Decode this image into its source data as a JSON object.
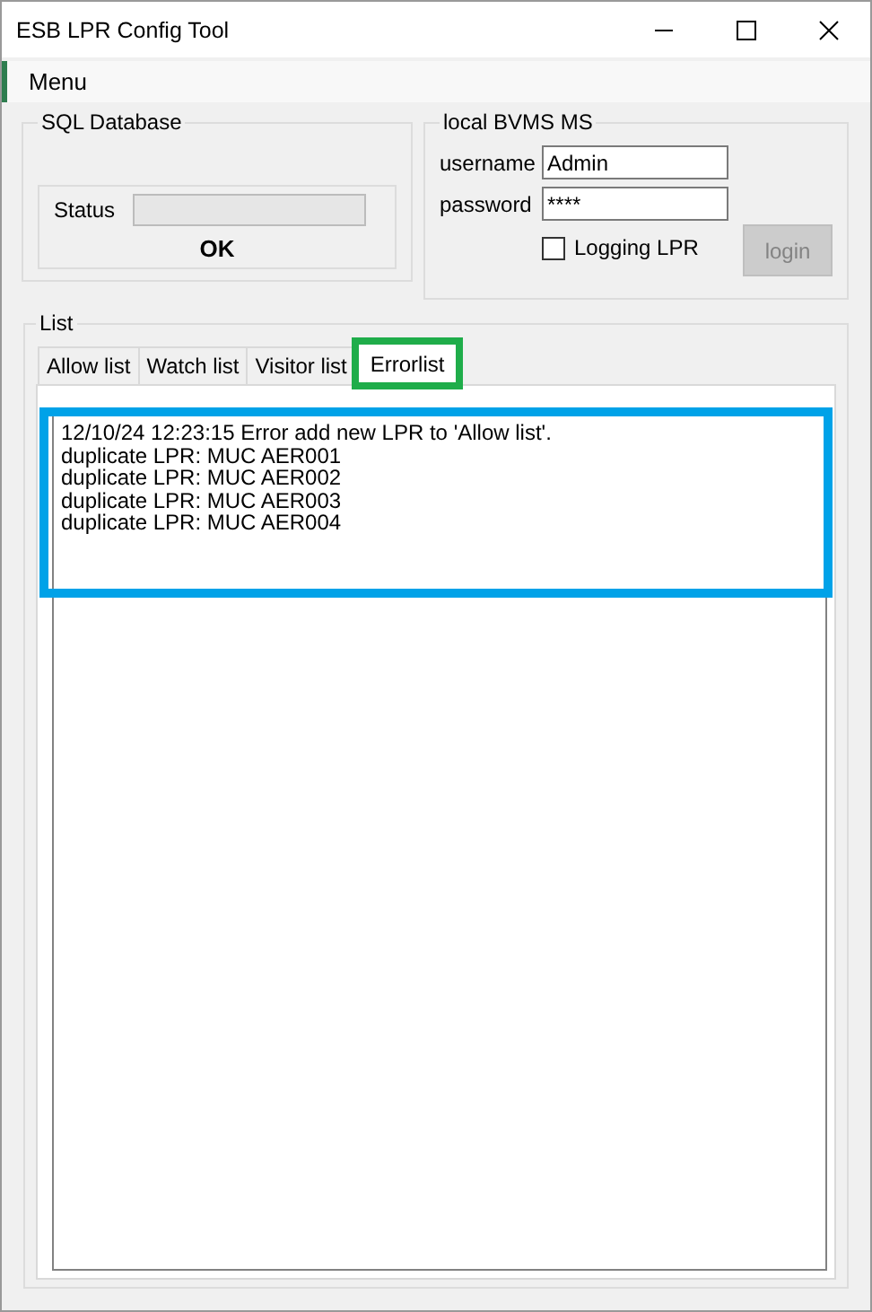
{
  "window": {
    "title": "ESB LPR Config Tool"
  },
  "menu": [
    "Menu"
  ],
  "sql_database": {
    "title": "SQL Database",
    "status_label": "Status",
    "status_bar": {
      "level": 0
    },
    "result": "OK"
  },
  "local_bvms": {
    "title": "local BVMS MS",
    "username_label": "username",
    "username": "Admin",
    "password_label": "password",
    "password": "****",
    "logging": {
      "label": "Logging LPR",
      "checked": false
    },
    "login_button": {
      "label": "login",
      "disabled": true
    }
  },
  "list": {
    "title": "List",
    "tabs": [
      {
        "label": "Allow list",
        "selected": false,
        "highlighted": false
      },
      {
        "label": "Watch list",
        "selected": false,
        "highlighted": false
      },
      {
        "label": "Visitor list",
        "selected": false,
        "highlighted": false
      },
      {
        "label": "Errorlist",
        "selected": true,
        "highlighted": true
      }
    ],
    "log": {
      "highlighted": true,
      "lines": [
        "12/10/24 12:23:15 Error add new LPR to 'Allow list'.",
        "duplicate LPR: MUC AER001",
        "duplicate LPR: MUC AER002",
        "duplicate LPR: MUC AER003",
        "duplicate LPR: MUC AER004"
      ]
    }
  }
}
